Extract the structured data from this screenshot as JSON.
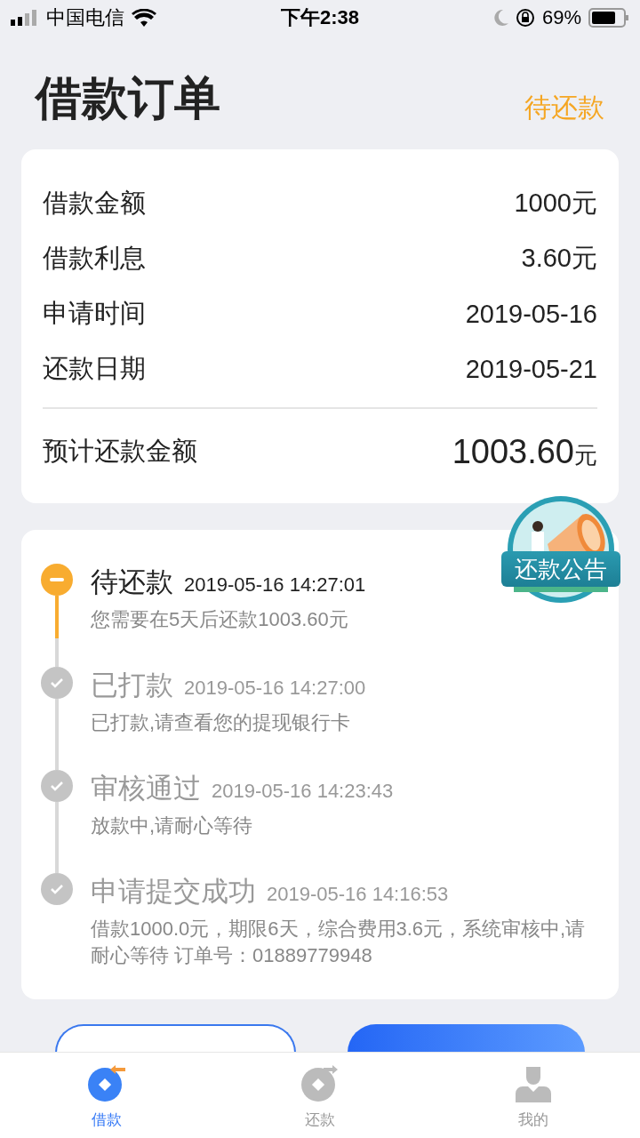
{
  "status_bar": {
    "carrier": "中国电信",
    "time": "下午2:38",
    "battery": "69%"
  },
  "header": {
    "title": "借款订单",
    "status": "待还款"
  },
  "summary": {
    "rows": [
      {
        "label": "借款金额",
        "value": "1000元"
      },
      {
        "label": "借款利息",
        "value": "3.60元"
      },
      {
        "label": "申请时间",
        "value": "2019-05-16"
      },
      {
        "label": "还款日期",
        "value": "2019-05-21"
      }
    ],
    "total": {
      "label": "预计还款金额",
      "amount": "1003.60",
      "unit": "元"
    }
  },
  "badge": {
    "label": "还款公告"
  },
  "timeline": [
    {
      "kind": "pending",
      "title": "待还款",
      "time": "2019-05-16 14:27:01",
      "detail": "您需要在5天后还款1003.60元"
    },
    {
      "kind": "done",
      "title": "已打款",
      "time": "2019-05-16 14:27:00",
      "detail": "已打款,请查看您的提现银行卡"
    },
    {
      "kind": "done",
      "title": "审核通过",
      "time": "2019-05-16 14:23:43",
      "detail": "放款中,请耐心等待"
    },
    {
      "kind": "done",
      "title": "申请提交成功",
      "time": "2019-05-16 14:16:53",
      "detail": "借款1000.0元，期限6天，综合费用3.6元，系统审核中,请耐心等待 订单号：01889779948"
    }
  ],
  "buttons": [
    {
      "kind": "outline"
    },
    {
      "kind": "primary"
    }
  ],
  "tab_bar": [
    {
      "label": "借款",
      "selected": true
    },
    {
      "label": "还款",
      "selected": false
    },
    {
      "label": "我的",
      "selected": false
    }
  ]
}
